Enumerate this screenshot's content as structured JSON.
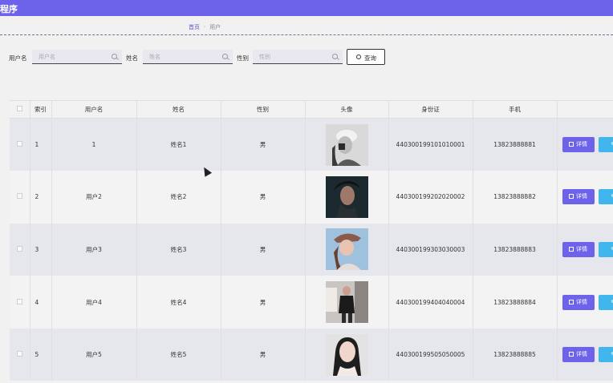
{
  "header": {
    "title": "程序"
  },
  "breadcrumb": {
    "home": "首页",
    "current": "用户"
  },
  "filters": [
    {
      "label": "用户名",
      "placeholder": "用户名"
    },
    {
      "label": "姓名",
      "placeholder": "姓名"
    },
    {
      "label": "性别",
      "placeholder": "性别"
    }
  ],
  "query_button": "查询",
  "table": {
    "columns": [
      "",
      "索引",
      "用户名",
      "姓名",
      "性别",
      "头像",
      "身份证",
      "手机",
      ""
    ],
    "rows": [
      {
        "index": "1",
        "username": "1",
        "name": "姓名1",
        "gender": "男",
        "id_card": "440300199101010001",
        "phone": "13823888881"
      },
      {
        "index": "2",
        "username": "用户2",
        "name": "姓名2",
        "gender": "男",
        "id_card": "440300199202020002",
        "phone": "13823888882"
      },
      {
        "index": "3",
        "username": "用户3",
        "name": "姓名3",
        "gender": "男",
        "id_card": "440300199303030003",
        "phone": "13823888883"
      },
      {
        "index": "4",
        "username": "用户4",
        "name": "姓名4",
        "gender": "男",
        "id_card": "440300199404040004",
        "phone": "13823888884"
      },
      {
        "index": "5",
        "username": "用户5",
        "name": "姓名5",
        "gender": "男",
        "id_card": "440300199505050005",
        "phone": "13823888885"
      }
    ],
    "detail_label": "详情"
  },
  "colors": {
    "primary": "#6c63ea",
    "edit": "#40b6ec"
  }
}
